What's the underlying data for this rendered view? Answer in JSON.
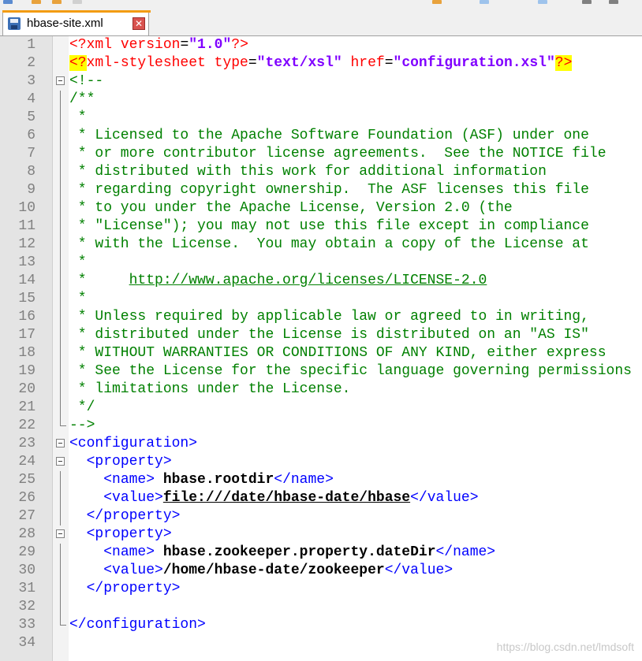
{
  "tab": {
    "label": "hbase-site.xml",
    "close_symbol": "✕"
  },
  "lines": [
    {
      "n": "1",
      "parts": [
        {
          "t": "<?",
          "c": "c-pi"
        },
        {
          "t": "xml",
          "c": "c-pi"
        },
        {
          "t": " version",
          "c": "c-attr"
        },
        {
          "t": "=",
          "c": ""
        },
        {
          "t": "\"1.0\"",
          "c": "c-val"
        },
        {
          "t": "?>",
          "c": "c-pi"
        }
      ]
    },
    {
      "n": "2",
      "parts": [
        {
          "t": "<?",
          "c": "c-pi hl"
        },
        {
          "t": "xml-stylesheet",
          "c": "c-pi"
        },
        {
          "t": " type",
          "c": "c-attr"
        },
        {
          "t": "=",
          "c": ""
        },
        {
          "t": "\"text/xsl\"",
          "c": "c-val"
        },
        {
          "t": " href",
          "c": "c-attr"
        },
        {
          "t": "=",
          "c": ""
        },
        {
          "t": "\"configuration.xsl\"",
          "c": "c-val"
        },
        {
          "t": "?>",
          "c": "c-pi hl"
        }
      ]
    },
    {
      "n": "3",
      "parts": [
        {
          "t": "<!--",
          "c": "c-comment"
        }
      ]
    },
    {
      "n": "4",
      "parts": [
        {
          "t": "/**",
          "c": "c-comment"
        }
      ]
    },
    {
      "n": "5",
      "parts": [
        {
          "t": " *",
          "c": "c-comment"
        }
      ]
    },
    {
      "n": "6",
      "parts": [
        {
          "t": " * Licensed to the Apache Software Foundation (ASF) under one",
          "c": "c-comment"
        }
      ]
    },
    {
      "n": "7",
      "parts": [
        {
          "t": " * or more contributor license agreements.  See the NOTICE file",
          "c": "c-comment"
        }
      ]
    },
    {
      "n": "8",
      "parts": [
        {
          "t": " * distributed with this work for additional information",
          "c": "c-comment"
        }
      ]
    },
    {
      "n": "9",
      "parts": [
        {
          "t": " * regarding copyright ownership.  The ASF licenses this file",
          "c": "c-comment"
        }
      ]
    },
    {
      "n": "10",
      "parts": [
        {
          "t": " * to you under the Apache License, Version 2.0 (the",
          "c": "c-comment"
        }
      ]
    },
    {
      "n": "11",
      "parts": [
        {
          "t": " * \"License\"); you may not use this file except in compliance",
          "c": "c-comment"
        }
      ]
    },
    {
      "n": "12",
      "parts": [
        {
          "t": " * with the License.  You may obtain a copy of the License at",
          "c": "c-comment"
        }
      ]
    },
    {
      "n": "13",
      "parts": [
        {
          "t": " *",
          "c": "c-comment"
        }
      ]
    },
    {
      "n": "14",
      "parts": [
        {
          "t": " *     ",
          "c": "c-comment"
        },
        {
          "t": "http://www.apache.org/licenses/LICENSE-2.0",
          "c": "c-comment c-underline"
        }
      ]
    },
    {
      "n": "15",
      "parts": [
        {
          "t": " *",
          "c": "c-comment"
        }
      ]
    },
    {
      "n": "16",
      "parts": [
        {
          "t": " * Unless required by applicable law or agreed to in writing,",
          "c": "c-comment"
        }
      ]
    },
    {
      "n": "17",
      "parts": [
        {
          "t": " * distributed under the License is distributed on an \"AS IS\"",
          "c": "c-comment"
        }
      ]
    },
    {
      "n": "18",
      "parts": [
        {
          "t": " * WITHOUT WARRANTIES OR CONDITIONS OF ANY KIND, either express",
          "c": "c-comment"
        }
      ]
    },
    {
      "n": "19",
      "parts": [
        {
          "t": " * See the License for the specific language governing permissions",
          "c": "c-comment"
        }
      ]
    },
    {
      "n": "20",
      "parts": [
        {
          "t": " * limitations under the License.",
          "c": "c-comment"
        }
      ]
    },
    {
      "n": "21",
      "parts": [
        {
          "t": " */",
          "c": "c-comment"
        }
      ]
    },
    {
      "n": "22",
      "parts": [
        {
          "t": "-->",
          "c": "c-comment"
        }
      ]
    },
    {
      "n": "23",
      "parts": [
        {
          "t": "<configuration>",
          "c": "c-tag"
        }
      ]
    },
    {
      "n": "24",
      "parts": [
        {
          "t": "  ",
          "c": ""
        },
        {
          "t": "<property>",
          "c": "c-tag"
        }
      ]
    },
    {
      "n": "25",
      "parts": [
        {
          "t": "    ",
          "c": ""
        },
        {
          "t": "<name>",
          "c": "c-tag"
        },
        {
          "t": " hbase.rootdir",
          "c": "c-text"
        },
        {
          "t": "</name>",
          "c": "c-tag"
        }
      ]
    },
    {
      "n": "26",
      "parts": [
        {
          "t": "    ",
          "c": ""
        },
        {
          "t": "<value>",
          "c": "c-tag"
        },
        {
          "t": "file:///date/hbase-date/hbase",
          "c": "c-text c-underline"
        },
        {
          "t": "</value>",
          "c": "c-tag"
        }
      ]
    },
    {
      "n": "27",
      "parts": [
        {
          "t": "  ",
          "c": ""
        },
        {
          "t": "</property>",
          "c": "c-tag"
        }
      ]
    },
    {
      "n": "28",
      "parts": [
        {
          "t": "  ",
          "c": ""
        },
        {
          "t": "<property>",
          "c": "c-tag"
        }
      ]
    },
    {
      "n": "29",
      "parts": [
        {
          "t": "    ",
          "c": ""
        },
        {
          "t": "<name>",
          "c": "c-tag"
        },
        {
          "t": " hbase.zookeeper.property.dateDir",
          "c": "c-text"
        },
        {
          "t": "</name>",
          "c": "c-tag"
        }
      ]
    },
    {
      "n": "30",
      "parts": [
        {
          "t": "    ",
          "c": ""
        },
        {
          "t": "<value>",
          "c": "c-tag"
        },
        {
          "t": "/home/hbase-date/zookeeper",
          "c": "c-text"
        },
        {
          "t": "</value>",
          "c": "c-tag"
        }
      ]
    },
    {
      "n": "31",
      "parts": [
        {
          "t": "  ",
          "c": ""
        },
        {
          "t": "</property>",
          "c": "c-tag"
        }
      ]
    },
    {
      "n": "32",
      "parts": []
    },
    {
      "n": "33",
      "parts": [
        {
          "t": "</configuration>",
          "c": "c-tag"
        }
      ]
    },
    {
      "n": "34",
      "parts": []
    }
  ],
  "folds": [
    {
      "line": "3",
      "kind": "open"
    },
    {
      "line": "22",
      "kind": "end"
    },
    {
      "line": "23",
      "kind": "open"
    },
    {
      "line": "24",
      "kind": "open"
    },
    {
      "line": "28",
      "kind": "open"
    },
    {
      "line": "33",
      "kind": "end"
    }
  ],
  "watermark": "https://blog.csdn.net/lmdsoft",
  "colors": {
    "tab_accent": "#f39c12",
    "highlight": "#ffff00",
    "comment": "#008000",
    "tag": "#0000ff"
  }
}
